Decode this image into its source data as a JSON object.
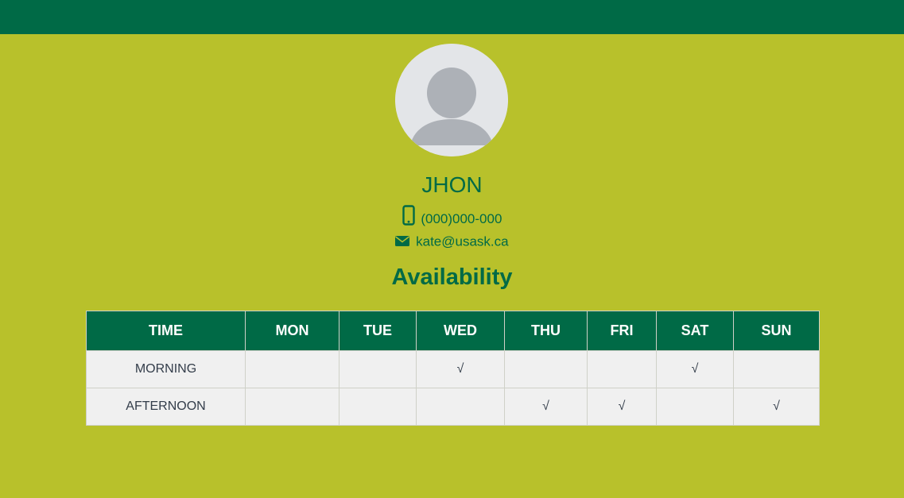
{
  "profile": {
    "avatar_icon": "user-silhouette-icon",
    "name": "JHON",
    "phone_icon": "mobile-phone-icon",
    "phone": "(000)000-000",
    "email_icon": "envelope-icon",
    "email": "kate@usask.ca"
  },
  "availability": {
    "title": "Availability",
    "columns": [
      "TIME",
      "MON",
      "TUE",
      "WED",
      "THU",
      "FRI",
      "SAT",
      "SUN"
    ],
    "rows": [
      {
        "label": "MORNING",
        "cells": [
          "",
          "",
          "√",
          "",
          "",
          "√",
          ""
        ]
      },
      {
        "label": "AFTERNOON",
        "cells": [
          "",
          "",
          "",
          "√",
          "√",
          "",
          "√"
        ]
      }
    ]
  },
  "colors": {
    "brand_green": "#006a46",
    "background": "#b8c12b",
    "cell_background": "#f0f0f0"
  }
}
